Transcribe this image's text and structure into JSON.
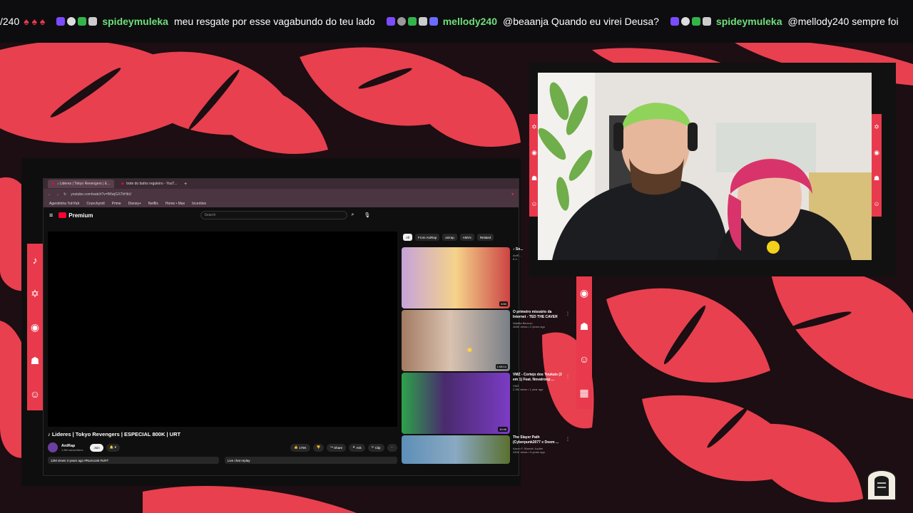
{
  "chat_ticker": [
    {
      "user": "",
      "message": "/240",
      "partial": true
    },
    {
      "user": "spideymuleka",
      "message": "meu resgate por esse vagabundo do teu lado"
    },
    {
      "user": "mellody240",
      "message": "@beaanja Quando eu virei Deusa?"
    },
    {
      "user": "spideymuleka",
      "message": "@mellody240 sempre foi"
    }
  ],
  "browser": {
    "tabs": [
      {
        "label": "♪ Lideres | Tokyo Revengers | E..."
      },
      {
        "label": "trote do bufos reguleiro - YouT..."
      }
    ],
    "url": "youtube.com/watch?v=fWwjGX7hHbU",
    "bookmarks": [
      "Agendinha YuhYah",
      "Crunchyroll",
      "Prime",
      "Disney+",
      "Netflix",
      "Home • Max",
      "Incentive"
    ]
  },
  "youtube": {
    "logo": "Premium",
    "search_placeholder": "Search",
    "video_title": "♪ Lideres | Tokyo Revengers | ESPECIAL 800K | URT",
    "channel_name": "AniRap",
    "channel_subs": "1.8M subscribers",
    "join_label": "Join",
    "likes": "176K",
    "share_label": "Share",
    "ask_label": "Ask",
    "clip_label": "Clip",
    "meta": "12M views  3 years ago  #Rurno1M #URT",
    "live_chat": "Live chat replay",
    "chips": [
      "All",
      "From AniRap",
      "anirap",
      "AMVs",
      "Related"
    ],
    "recommendations": [
      {
        "title": "♪ Sn...",
        "channel": "AniR...",
        "views": "6.4...",
        "duration": "5:50"
      },
      {
        "title": "O primeiro missário da Internet - TED THE CAVER",
        "channel": "Natalia Barrozo",
        "views": "468K views • 2 years ago",
        "duration": "1:08:14"
      },
      {
        "title": "VMZ - Cortejo dos Youkais (3 em 1) Feat. Novatroop ...",
        "channel": "VMZ",
        "views": "2.3M views • 1 year ago",
        "duration": "10:46"
      },
      {
        "title": "The Slayer Path (Cyberpunk2077 x Doom ...",
        "channel": "Aaron F. Bianchi Jupiter",
        "views": "430K views • 5 years ago",
        "duration": ""
      }
    ]
  },
  "colors": {
    "accent": "#e83a4c",
    "ticker_user": "#6ee07a",
    "yt_red": "#ff0033"
  },
  "icons": [
    "mic-icon",
    "pentagram-icon",
    "eye-icon",
    "ghost-icon",
    "smile-icon"
  ]
}
